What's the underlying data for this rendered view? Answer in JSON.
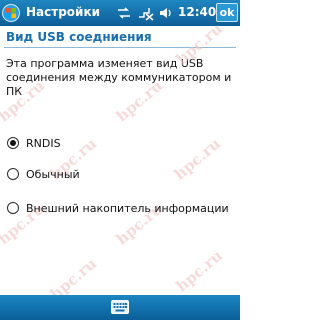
{
  "statusbar": {
    "title": "Настройки",
    "time": "12:40",
    "ok_label": "ok",
    "icons": [
      "windows-logo-icon",
      "connectivity-icon",
      "signal-off-icon",
      "volume-icon"
    ]
  },
  "header": {
    "title": "Вид USB соедниения"
  },
  "description": "Эта программа изменяет вид USB соединения между коммуникатором и ПК",
  "options": [
    {
      "label": "RNDIS",
      "selected": true
    },
    {
      "label": "Обычный",
      "selected": false
    },
    {
      "label": "Внешний накопитель информации",
      "selected": false
    }
  ],
  "watermark": "hpc.ru",
  "bottombar": {
    "icon": "keyboard-icon"
  },
  "colors": {
    "bar": "#0e6aa8",
    "header_text": "#1a6fae",
    "watermark": "#f2c7c7"
  }
}
